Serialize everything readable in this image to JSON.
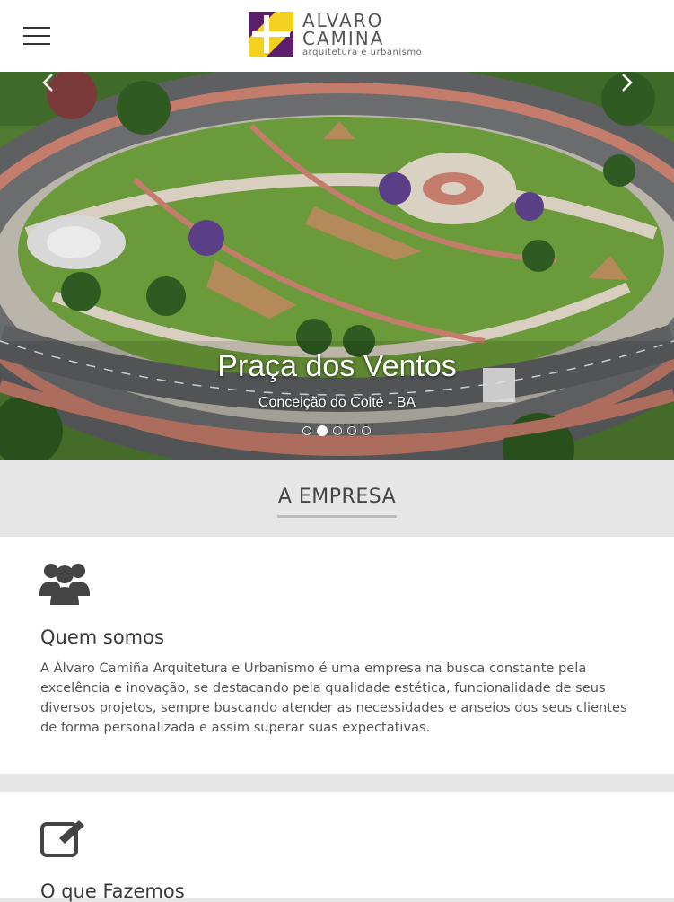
{
  "header": {
    "menu_icon": "hamburger-menu-icon",
    "logo": {
      "line1": "ALVARO",
      "line2": "CAMINA",
      "tagline": "arquitetura e urbanismo",
      "colors": {
        "yellow": "#f2d21f",
        "purple": "#5c1f6b",
        "text": "#555555"
      }
    }
  },
  "hero": {
    "slide_title": "Praça dos Ventos",
    "slide_subtitle": "Conceição do Coité - BA",
    "prev_icon": "chevron-left-icon",
    "next_icon": "chevron-right-icon",
    "slide_count": 5,
    "active_slide": 2
  },
  "section": {
    "title": "A EMPRESA"
  },
  "cards": [
    {
      "icon": "users-group-icon",
      "title": "Quem somos",
      "text": "A Álvaro Camiña Arquitetura e Urbanismo é uma empresa na busca constante pela excelência e inovação, se destacando pela qualidade estética, funcionalidade de seus diversos projetos, sempre buscando atender as necessidades e anseios dos seus clientes de forma personalizada e assim superar suas expectativas."
    },
    {
      "icon": "edit-pencil-icon",
      "title": "O que Fazemos"
    }
  ]
}
